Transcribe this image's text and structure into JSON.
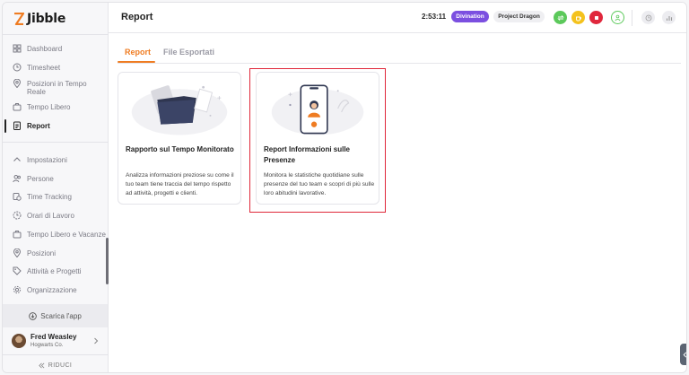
{
  "app": {
    "name": "Jibble"
  },
  "sidebar": {
    "items": [
      {
        "label": "Dashboard"
      },
      {
        "label": "Timesheet"
      },
      {
        "label": "Posizioni in Tempo Reale"
      },
      {
        "label": "Tempo Libero"
      },
      {
        "label": "Report"
      }
    ],
    "settings": [
      {
        "label": "Impostazioni"
      },
      {
        "label": "Persone"
      },
      {
        "label": "Time Tracking"
      },
      {
        "label": "Orari di Lavoro"
      },
      {
        "label": "Tempo Libero e Vacanze"
      },
      {
        "label": "Posizioni"
      },
      {
        "label": "Attività e Progetti"
      },
      {
        "label": "Organizzazione"
      }
    ],
    "download_app": "Scarica l'app",
    "user": {
      "name": "Fred Weasley",
      "org": "Hogwarts Co."
    },
    "collapse": "RIDUCI"
  },
  "header": {
    "title": "Report",
    "timer": "2:53:11",
    "activity": "Divination",
    "project": "Project Dragon"
  },
  "tabs": [
    {
      "label": "Report"
    },
    {
      "label": "File Esportati"
    }
  ],
  "cards": [
    {
      "title": "Rapporto sul Tempo Monitorato",
      "description": "Analizza informazioni preziose su come il tuo team tiene traccia del tempo rispetto ad attività, progetti e clienti."
    },
    {
      "title": "Report Informazioni sulle Presenze",
      "description": "Monitora le statistiche quotidiane sulle presenze del tuo team e scopri di più sulle loro abitudini lavorative."
    }
  ],
  "colors": {
    "accent": "#ef7c22",
    "activity_pill": "#7b4fe0",
    "highlight": "#e0283a"
  }
}
